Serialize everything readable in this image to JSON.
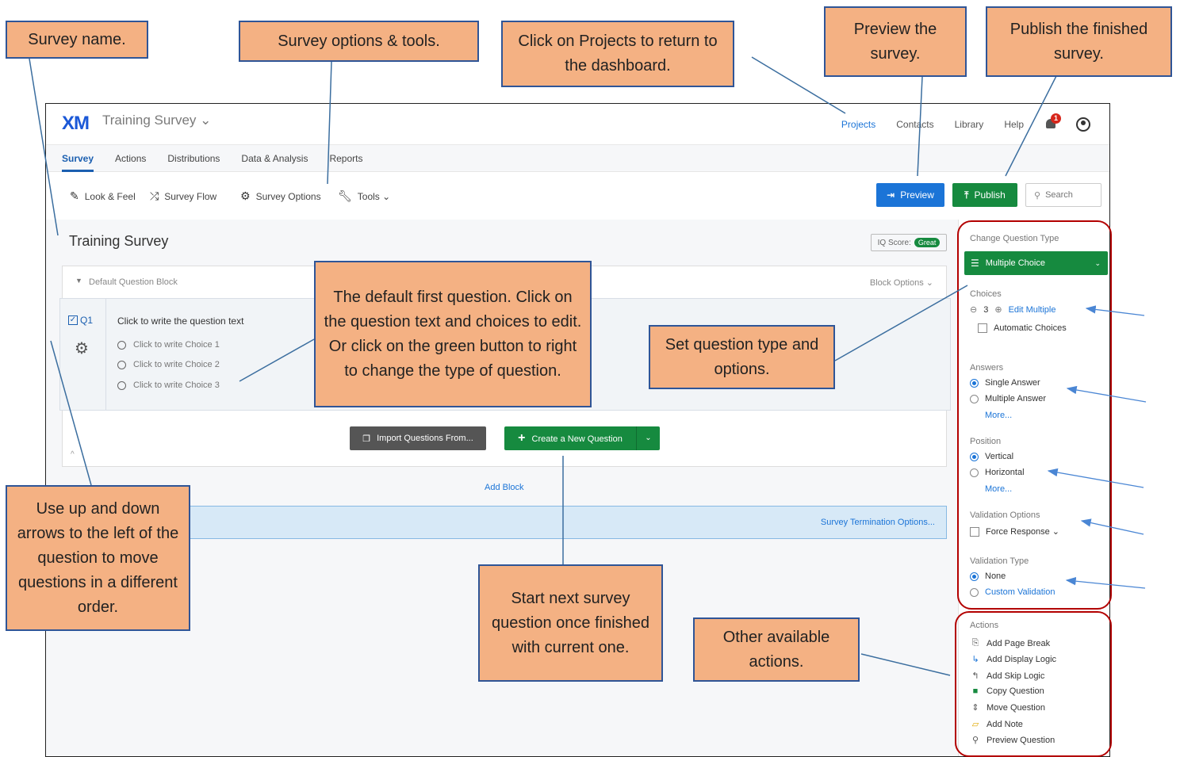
{
  "app": {
    "logo": "XM",
    "survey_title": "Training Survey ⌄",
    "top_nav": {
      "projects": "Projects",
      "contacts": "Contacts",
      "library": "Library",
      "help": "Help",
      "notifications": "1"
    }
  },
  "tabs": [
    "Survey",
    "Actions",
    "Distributions",
    "Data & Analysis",
    "Reports"
  ],
  "toolbar": {
    "look_feel": "Look & Feel",
    "survey_flow": "Survey Flow",
    "survey_options": "Survey Options",
    "tools": "Tools ⌄",
    "preview": "Preview",
    "publish": "Publish",
    "search_placeholder": "Search"
  },
  "editor": {
    "page_title": "Training Survey",
    "iq_score_label": "IQ Score:",
    "iq_score_value": "Great",
    "block_name": "Default Question Block",
    "block_options": "Block Options ⌄",
    "question": {
      "number": "Q1",
      "text": "Click to write the question text",
      "choices": [
        "Click to write Choice 1",
        "Click to write Choice 2",
        "Click to write Choice 3"
      ]
    },
    "import_button": "Import Questions From...",
    "create_button": "Create a New Question",
    "add_block": "Add Block",
    "termination": "Survey Termination Options..."
  },
  "panel": {
    "change_type_label": "Change Question Type",
    "question_type": "Multiple Choice",
    "choices_label": "Choices",
    "choices_count": "3",
    "edit_multiple": "Edit Multiple",
    "automatic_choices": "Automatic Choices",
    "answers_label": "Answers",
    "single_answer": "Single Answer",
    "multiple_answer": "Multiple Answer",
    "more": "More...",
    "position_label": "Position",
    "vertical": "Vertical",
    "horizontal": "Horizontal",
    "validation_options_label": "Validation Options",
    "force_response": "Force Response ⌄",
    "validation_type_label": "Validation Type",
    "none": "None",
    "custom_validation": "Custom Validation",
    "actions_label": "Actions",
    "actions": [
      "Add Page Break",
      "Add Display Logic",
      "Add Skip Logic",
      "Copy Question",
      "Move Question",
      "Add Note",
      "Preview Question"
    ]
  },
  "callouts": {
    "survey_name": "Survey name.",
    "survey_options_tools": "Survey options & tools.",
    "projects": "Click on Projects to return to the dashboard.",
    "preview": "Preview the survey.",
    "publish": "Publish the finished survey.",
    "default_question": "The default first question. Click on the question text and choices to edit. Or click on the green button to right to change the type of question.",
    "set_question_type": "Set question type and options.",
    "reorder": "Use up and down arrows to the left of the question to move questions in a different order.",
    "next_question": "Start next survey question once finished with current one.",
    "other_actions": "Other available actions."
  },
  "colors": {
    "callout_fill": "#f4b183",
    "callout_border": "#2f5597",
    "highlight_border": "#b30000",
    "brand_blue": "#1b74d7",
    "brand_green": "#168a3f"
  }
}
